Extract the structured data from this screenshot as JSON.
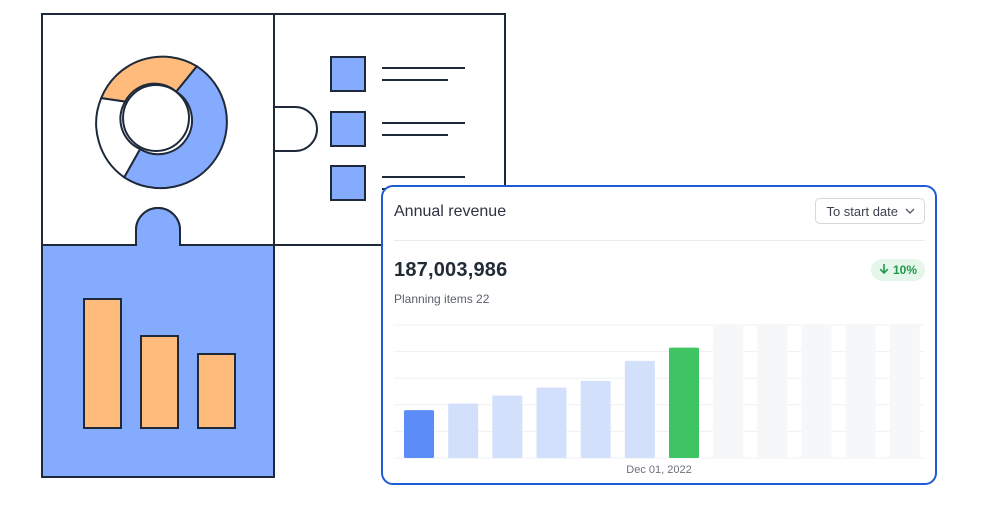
{
  "card": {
    "title": "Annual revenue",
    "date_filter": {
      "label": "To start date",
      "icon": "chevron-down-icon"
    },
    "total_value": "187,003,986",
    "change": {
      "icon": "arrow-down-icon",
      "label": "10%",
      "color": "#1f9a4a",
      "background": "#e5f6ea"
    },
    "subtitle": "Planning items 22",
    "date_label": "Dec 01, 2022",
    "border_color": "#1f5bd6"
  },
  "chart_data": {
    "type": "bar",
    "series": [
      {
        "values": [
          0.36,
          0.41,
          0.47,
          0.53,
          0.58,
          0.73,
          0.83,
          0,
          0,
          0,
          0,
          0
        ]
      }
    ],
    "bar_colors": [
      "#5b8cf7",
      "#d3e0fb",
      "#d3e0fb",
      "#d3e0fb",
      "#d3e0fb",
      "#d3e0fb",
      "#3ec463",
      "#f6f7f9",
      "#f6f7f9",
      "#f6f7f9",
      "#f6f7f9",
      "#f6f7f9"
    ],
    "grid": true
  },
  "illustration": {
    "colors": {
      "stroke": "#1e2a3a",
      "blue": "#85abff",
      "orange": "#ffbb7c",
      "white": "#ffffff"
    },
    "donut": [
      0.28,
      0.45,
      0.27
    ],
    "bars": [
      0.87,
      0.62,
      0.5
    ]
  }
}
